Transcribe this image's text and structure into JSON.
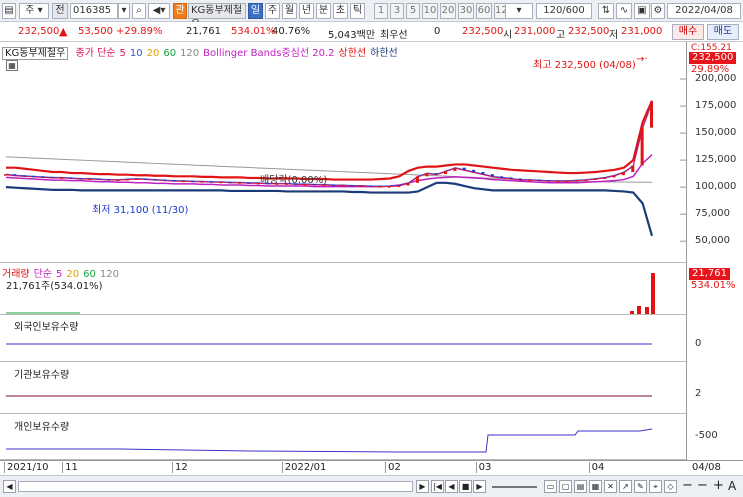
{
  "toolbar": {
    "period_select": "주",
    "compare_label": "전",
    "code_value": "016385",
    "badge": "관",
    "stock_name": "KG동부제철우",
    "period_tabs": [
      "일",
      "주",
      "월",
      "년",
      "분",
      "초",
      "틱"
    ],
    "active_tab": "일",
    "intervals": [
      "1",
      "3",
      "5",
      "10",
      "20",
      "30",
      "60",
      "120"
    ],
    "count_value": "120/600",
    "date_value": "2022/04/08"
  },
  "quote": {
    "price": "232,500",
    "change": "53,500",
    "change_pct": "+29.89%",
    "volume": "21,761",
    "volume_pct": "534.01%",
    "turnover": "40.76%",
    "amount": "5,043백만",
    "best_label": "최우선",
    "best_value": "0",
    "last_value": "232,500",
    "open_label": "시",
    "open_value": "231,000",
    "high_label": "고",
    "high_value": "232,500",
    "low_label": "저",
    "low_value": "231,000",
    "buy_button": "매수",
    "sell_button": "매도"
  },
  "price_panel": {
    "name_box": "KG동부제철우",
    "legend": [
      {
        "text": "종가 단순",
        "color": "#e0145a"
      },
      {
        "text": "5",
        "color": "#e0145a"
      },
      {
        "text": "10",
        "color": "#2a54d8"
      },
      {
        "text": "20",
        "color": "#e0a000"
      },
      {
        "text": "60",
        "color": "#18a040"
      },
      {
        "text": "120",
        "color": "#888888"
      },
      {
        "text": "Bollinger Bands중심선 20.2",
        "color": "#c020c0"
      },
      {
        "text": "상한선",
        "color": "#e01414"
      },
      {
        "text": "하한선",
        "color": "#1a3a7a"
      }
    ],
    "high_annotation": "최고 232,500 (04/08)",
    "low_annotation": "최저 31,100 (11/30)",
    "dividend_annotation": "배당락(0.00%)",
    "y_labels": [
      "200,000",
      "175,000",
      "150,000",
      "125,000",
      "100,000",
      "75,000",
      "50,000"
    ],
    "tag_top": "C:155.21",
    "tag_price": "232,500",
    "tag_pct": "29.89%",
    "y_min": 40000,
    "y_max": 225000,
    "close": [
      112000,
      111000,
      110500,
      110000,
      109500,
      109000,
      109000,
      108500,
      108000,
      108000,
      107500,
      107000,
      107000,
      107500,
      108000,
      107500,
      107000,
      106500,
      106000,
      106000,
      105500,
      105500,
      105000,
      105000,
      104500,
      104500,
      104000,
      104000,
      103500,
      103500,
      103500,
      103000,
      103000,
      102500,
      102500,
      102000,
      102000,
      101500,
      101500,
      101000,
      101000,
      101000,
      101500,
      104000,
      110000,
      113000,
      112000,
      115000,
      118000,
      116000,
      114000,
      112000,
      110000,
      109000,
      108000,
      107000,
      107000,
      106500,
      106000,
      106000,
      106000,
      106500,
      107000,
      108000,
      109000,
      111000,
      114000,
      120000,
      155000,
      179000
    ],
    "upper": [
      118000,
      118000,
      117000,
      116000,
      115000,
      114000,
      114000,
      113000,
      113000,
      112500,
      112000,
      112000,
      111500,
      111500,
      111000,
      111000,
      110500,
      110500,
      110000,
      110000,
      110000,
      109500,
      109500,
      109000,
      109000,
      109000,
      108500,
      108500,
      108000,
      108000,
      108000,
      108000,
      107500,
      107500,
      107500,
      107000,
      107000,
      107000,
      107000,
      107000,
      107500,
      108000,
      110000,
      115000,
      118000,
      119000,
      119000,
      120000,
      121000,
      121000,
      120000,
      119000,
      118000,
      117000,
      116000,
      115500,
      115000,
      114500,
      114000,
      113500,
      113000,
      113000,
      113500,
      114000,
      115000,
      116000,
      118000,
      125000,
      160000,
      180000
    ],
    "lower": [
      100000,
      99500,
      99000,
      98500,
      98000,
      97500,
      97500,
      97500,
      97000,
      97000,
      97000,
      97000,
      97000,
      97000,
      97000,
      97000,
      97000,
      97000,
      97000,
      97000,
      97000,
      97000,
      97000,
      97000,
      96500,
      96500,
      96500,
      96500,
      96500,
      96500,
      96000,
      96000,
      96000,
      96000,
      96000,
      96000,
      96000,
      95500,
      95500,
      95000,
      95000,
      95000,
      95000,
      95000,
      96000,
      100000,
      104000,
      104000,
      103000,
      101000,
      99000,
      98000,
      97000,
      97000,
      97000,
      97000,
      97000,
      97000,
      97000,
      97000,
      97000,
      97000,
      97000,
      97000,
      97000,
      96500,
      96000,
      95000,
      85000,
      55000
    ],
    "mid": [
      109000,
      108500,
      108000,
      107500,
      107000,
      106500,
      106500,
      106000,
      106000,
      105500,
      105000,
      105000,
      104500,
      104500,
      104000,
      104000,
      103500,
      103500,
      103000,
      103000,
      103000,
      102500,
      102500,
      102000,
      102000,
      102000,
      101500,
      101500,
      101000,
      101000,
      101000,
      101000,
      101000,
      100500,
      100500,
      100500,
      100500,
      100500,
      100500,
      100500,
      100500,
      101000,
      102000,
      104000,
      106000,
      107500,
      108500,
      109000,
      109500,
      109000,
      108500,
      108000,
      107000,
      106500,
      106000,
      105500,
      105000,
      104500,
      104000,
      104000,
      104000,
      104000,
      104500,
      105000,
      105500,
      106000,
      107000,
      110000,
      122000,
      130000
    ]
  },
  "volume_panel": {
    "legend": [
      {
        "text": "거래량",
        "color": "#e01414"
      },
      {
        "text": "단순",
        "color": "#c020c0"
      },
      {
        "text": "5",
        "color": "#c020c0"
      },
      {
        "text": "20",
        "color": "#e0a000"
      },
      {
        "text": "60",
        "color": "#18a040"
      },
      {
        "text": "120",
        "color": "#888888"
      }
    ],
    "value_line": "21,761주(534.01%)",
    "tag_value": "21,761",
    "tag_pct": "534.01%"
  },
  "foreign_panel": {
    "title": "외국인보유수량",
    "y_label": "0"
  },
  "inst_panel": {
    "title": "기관보유수량",
    "y_label": "2"
  },
  "indiv_panel": {
    "title": "개인보유수량",
    "y_label": "-500"
  },
  "x_labels": [
    {
      "text": "2021/10",
      "pos": 0.0
    },
    {
      "text": "11",
      "pos": 0.09
    },
    {
      "text": "12",
      "pos": 0.26
    },
    {
      "text": "2022/01",
      "pos": 0.43
    },
    {
      "text": "02",
      "pos": 0.59
    },
    {
      "text": "03",
      "pos": 0.73
    },
    {
      "text": "04",
      "pos": 0.905
    }
  ],
  "x_right_label": "04/08"
}
